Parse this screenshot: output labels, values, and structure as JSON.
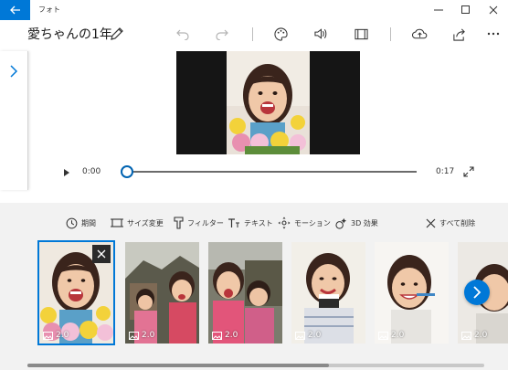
{
  "window": {
    "app_title": "フォト",
    "controls": [
      "minimize-icon",
      "maximize-icon",
      "close-icon"
    ]
  },
  "header": {
    "project_title": "愛ちゃんの1年",
    "tools": [
      "undo-icon",
      "redo-icon",
      "palette-icon",
      "volume-icon",
      "aspect-ratio-icon",
      "cloud-upload-icon",
      "share-icon",
      "more-icon"
    ]
  },
  "player": {
    "current_time": "0:00",
    "end_time": "0:17",
    "progress": 0
  },
  "storyboard": {
    "tools": [
      {
        "label": "期間",
        "icon": "clock-icon"
      },
      {
        "label": "サイズ変更",
        "icon": "resize-icon"
      },
      {
        "label": "フィルター",
        "icon": "filter-icon"
      },
      {
        "label": "テキスト",
        "icon": "text-icon"
      },
      {
        "label": "モーション",
        "icon": "motion-icon"
      },
      {
        "label": "3D 効果",
        "icon": "3d-effects-icon"
      }
    ],
    "remove_all_label": "すべて削除",
    "clips": [
      {
        "duration": "2.0",
        "selected": true
      },
      {
        "duration": "2.0",
        "selected": false
      },
      {
        "duration": "2.0",
        "selected": false
      },
      {
        "duration": "2.0",
        "selected": false
      },
      {
        "duration": "2.0",
        "selected": false
      },
      {
        "duration": "2.0",
        "selected": false
      }
    ]
  },
  "colors": {
    "accent": "#0078d7",
    "preview_bg": "#151515",
    "storyboard_bg": "#f2f2f2"
  }
}
